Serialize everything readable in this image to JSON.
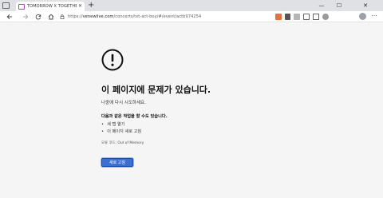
{
  "browser": {
    "tab_title": "TOMORROW X TOGETHER LIVE",
    "tab_close": "✕",
    "new_tab": "+",
    "url_prefix": "https://",
    "url_domain": "venewlive.com",
    "url_path": "/concerts/txt-act-boy/#/event/actb974254",
    "win_minimize": "—",
    "win_maximize": "☐",
    "win_close": "✕"
  },
  "error": {
    "heading": "이 페이지에 문제가 있습니다.",
    "subtext": "나중에 다시 시도하세요.",
    "suggestions_title": "다음과 같은 작업을 할 수도 있습니다.",
    "suggestions": [
      "새 탭 열기",
      "이 페이지 새로 고침"
    ],
    "error_code": "오류 코드: Out of Memory",
    "reload_button": "새로 고침"
  },
  "colors": {
    "accent": "#3b6fd0",
    "background": "#f5f5f5"
  }
}
